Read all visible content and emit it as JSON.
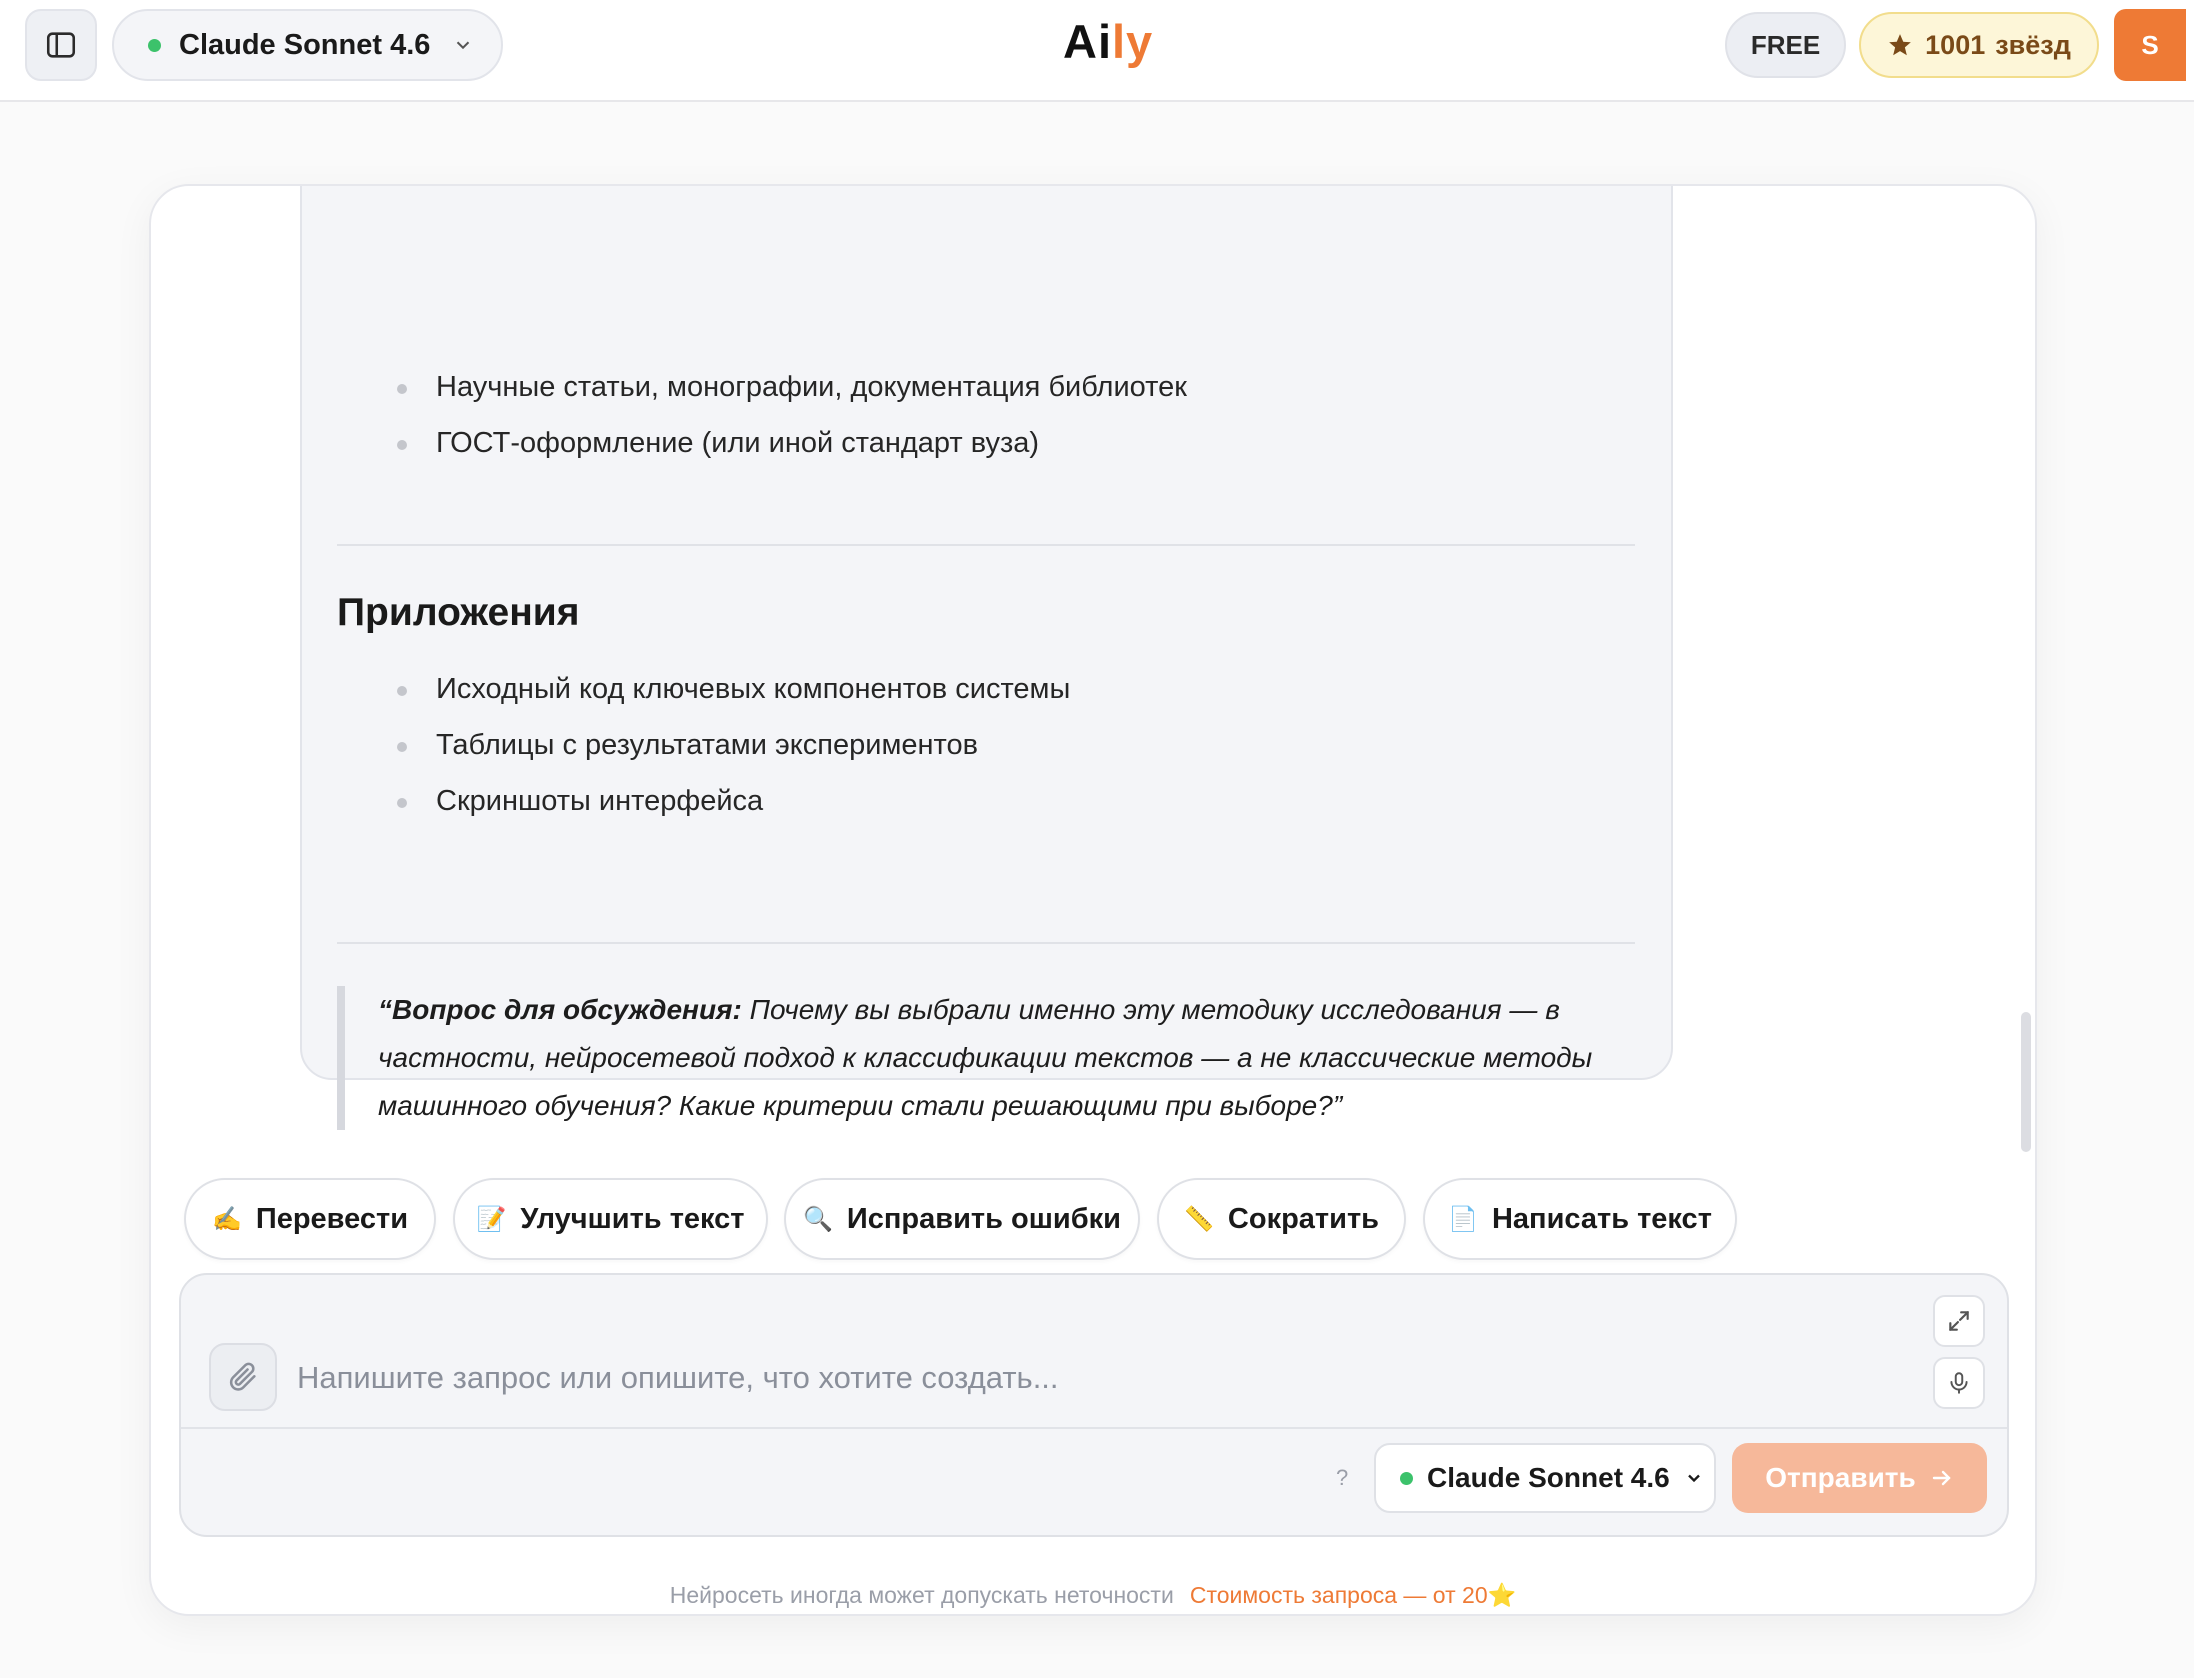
{
  "header": {
    "model_name": "Claude Sonnet 4.6",
    "logo_part1": "Ai",
    "logo_part2": "ly",
    "plan_badge": "FREE",
    "stars_count": "1001",
    "stars_label": "звёзд",
    "avatar_initial": "S",
    "icons": [
      "sidebar-toggle-icon",
      "chevron-down-icon",
      "star-icon"
    ]
  },
  "message": {
    "bullets_top": [
      "Научные статьи, монографии, документация библиотек",
      "ГОСТ-оформление (или иной стандарт вуза)"
    ],
    "section_title": "Приложения",
    "bullets_appendix": [
      "Исходный код ключевых компонентов системы",
      "Таблицы с результатами экспериментов",
      "Скриншоты интерфейса"
    ],
    "quote_label": "“Вопрос для обсуждения:",
    "quote_text": " Почему вы выбрали именно эту методику исследования — в частности, нейросетевой подход к классификации текстов — а не классические методы машинного обучения? Какие критерии стали решающими при выборе?”"
  },
  "quick_actions": [
    {
      "emoji": "✍️",
      "label": "Перевести"
    },
    {
      "emoji": "📝",
      "label": "Улучшить текст"
    },
    {
      "emoji": "🔍",
      "label": "Исправить ошибки"
    },
    {
      "emoji": "📏",
      "label": "Сократить"
    },
    {
      "emoji": "📄",
      "label": "Написать текст"
    }
  ],
  "composer": {
    "placeholder": "Напишите запрос или опишите, что хотите создать...",
    "value": "",
    "help_mark": "?",
    "model_name": "Claude Sonnet 4.6",
    "send_label": "Отправить",
    "icons": [
      "paperclip-icon",
      "expand-icon",
      "microphone-icon",
      "chevron-down-icon",
      "arrow-right-icon"
    ]
  },
  "footer": {
    "note": "Нейросеть иногда может допускать неточности",
    "cost": "Стоимость запроса — от 20⭐"
  },
  "colors": {
    "accent": "#ee7a35",
    "status_green": "#3cc26b",
    "send_disabled": "#f6b89a",
    "stars_bg": "#fdf6d8"
  }
}
